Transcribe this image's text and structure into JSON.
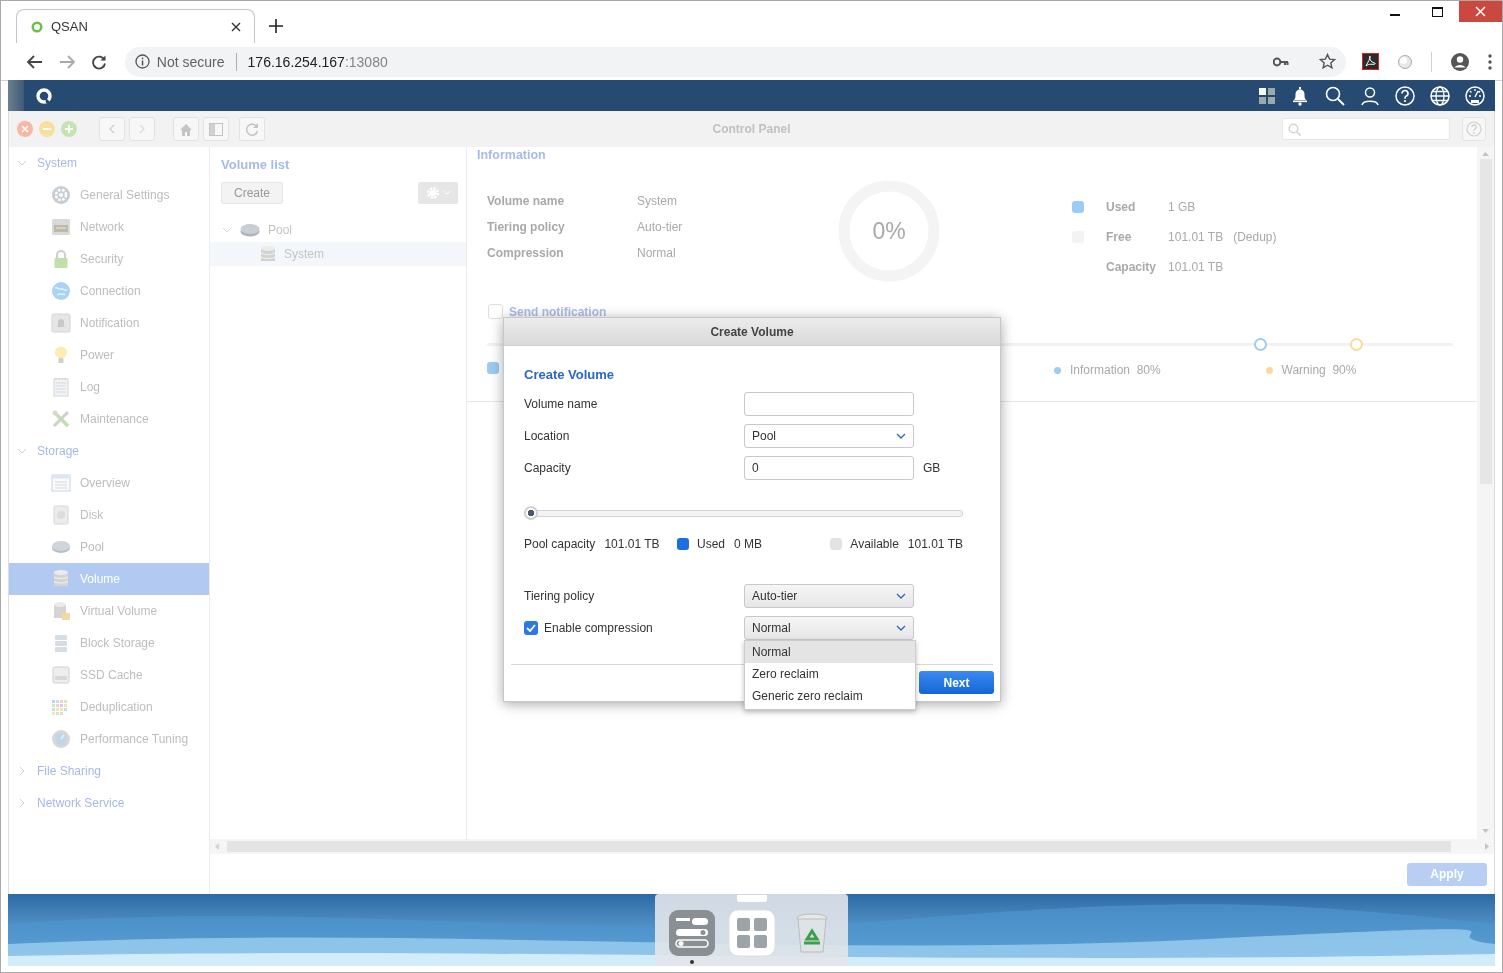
{
  "browser": {
    "tab": {
      "title": "QSAN"
    },
    "address": {
      "security": "Not secure",
      "host": "176.16.254.167",
      "port": ":13080"
    }
  },
  "control_panel": {
    "title": "Control Panel",
    "sidebar": {
      "groups": [
        {
          "label": "System",
          "expanded": true,
          "items": [
            {
              "label": "General Settings",
              "selected": false
            },
            {
              "label": "Network",
              "selected": false
            },
            {
              "label": "Security",
              "selected": false
            },
            {
              "label": "Connection",
              "selected": false
            },
            {
              "label": "Notification",
              "selected": false
            },
            {
              "label": "Power",
              "selected": false
            },
            {
              "label": "Log",
              "selected": false
            },
            {
              "label": "Maintenance",
              "selected": false
            }
          ]
        },
        {
          "label": "Storage",
          "expanded": true,
          "items": [
            {
              "label": "Overview",
              "selected": false
            },
            {
              "label": "Disk",
              "selected": false
            },
            {
              "label": "Pool",
              "selected": false
            },
            {
              "label": "Volume",
              "selected": true
            },
            {
              "label": "Virtual Volume",
              "selected": false
            },
            {
              "label": "Block Storage",
              "selected": false
            },
            {
              "label": "SSD Cache",
              "selected": false
            },
            {
              "label": "Deduplication",
              "selected": false
            },
            {
              "label": "Performance Tuning",
              "selected": false
            }
          ]
        },
        {
          "label": "File Sharing",
          "expanded": false
        },
        {
          "label": "Network Service",
          "expanded": false
        }
      ]
    },
    "volume_list": {
      "title": "Volume list",
      "create_button": "Create",
      "tree": [
        {
          "label": "Pool",
          "expanded": true,
          "selected": false,
          "children": [
            {
              "label": "System",
              "selected": true
            }
          ]
        }
      ]
    },
    "information": {
      "title": "Information",
      "fields": [
        {
          "label": "Volume name",
          "value": "System"
        },
        {
          "label": "Tiering policy",
          "value": "Auto-tier"
        },
        {
          "label": "Compression",
          "value": "Normal"
        }
      ],
      "usage": "0%",
      "legend": [
        {
          "label": "Used",
          "value": "1 GB",
          "color": "#9ccbf3"
        },
        {
          "label": "Free",
          "value": "101.01 TB",
          "note": "(Dedup)",
          "color": "#f3f3f3"
        },
        {
          "label": "Capacity",
          "value": "101.01 TB"
        }
      ],
      "send_notification": {
        "label": "Send notification",
        "checked": false
      },
      "thresholds": [
        {
          "label": "Information",
          "value": "80%",
          "level": 0.8,
          "color": "#9ccbf3"
        },
        {
          "label": "Warning",
          "value": "90%",
          "level": 0.9,
          "color": "#f8dc9c"
        }
      ]
    },
    "apply_button": "Apply"
  },
  "dialog": {
    "title": "Create Volume",
    "heading": "Create Volume",
    "fields": [
      {
        "kind": "text",
        "label": "Volume name"
      },
      {
        "kind": "select",
        "label": "Location",
        "value": "Pool"
      },
      {
        "kind": "number",
        "label": "Capacity",
        "value": "0",
        "unit": "GB"
      }
    ],
    "capacity_slider": {
      "level": 0
    },
    "pool_summary": [
      {
        "kind": "text",
        "label": "Pool capacity",
        "value": "101.01 TB"
      },
      {
        "kind": "swatch",
        "label": "Used",
        "value": "0 MB",
        "color": "#1a6ee0"
      },
      {
        "kind": "swatch",
        "label": "Available",
        "value": "101.01 TB",
        "color": "#e3e3e3"
      }
    ],
    "options": [
      {
        "kind": "select",
        "label": "Tiering policy",
        "value": "Auto-tier"
      },
      {
        "kind": "check-select",
        "label": "Enable compression",
        "checked": true,
        "value": "Normal",
        "expanded": true,
        "choices": [
          {
            "label": "Normal",
            "selected": true
          },
          {
            "label": "Zero reclaim",
            "selected": false
          },
          {
            "label": "Generic zero reclaim",
            "selected": false
          }
        ]
      }
    ],
    "next_button": "Next"
  },
  "dock": [
    {
      "kind": "settings",
      "running": true
    },
    {
      "kind": "apps",
      "running": false
    },
    {
      "kind": "recycle-bin",
      "running": false
    }
  ]
}
